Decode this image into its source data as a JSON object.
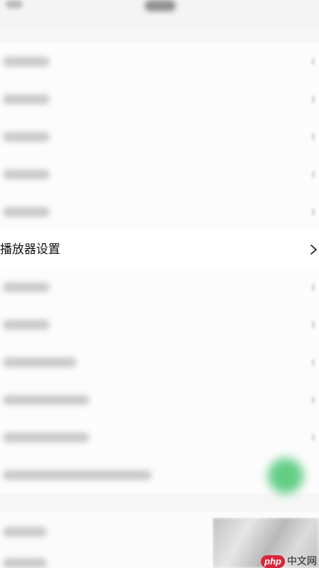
{
  "settings_list": {
    "rows": [
      {
        "blurred": true,
        "label_width": 66
      },
      {
        "blurred": true,
        "label_width": 66
      },
      {
        "blurred": true,
        "label_width": 66
      },
      {
        "blurred": true,
        "label_width": 66
      },
      {
        "blurred": true,
        "label_width": 66
      },
      {
        "blurred": false,
        "label": "播放器设置"
      },
      {
        "blurred": true,
        "label_width": 66
      },
      {
        "blurred": true,
        "label_width": 66
      },
      {
        "blurred": true,
        "label_width": 104
      },
      {
        "blurred": true,
        "label_width": 122
      },
      {
        "blurred": true,
        "label_width": 122
      },
      {
        "blurred": true,
        "label_width": 210
      }
    ]
  },
  "watermark": {
    "brand": "php",
    "site": "中文网"
  },
  "colors": {
    "accent_green": "#53c97a",
    "watermark_red": "#d7263d"
  }
}
